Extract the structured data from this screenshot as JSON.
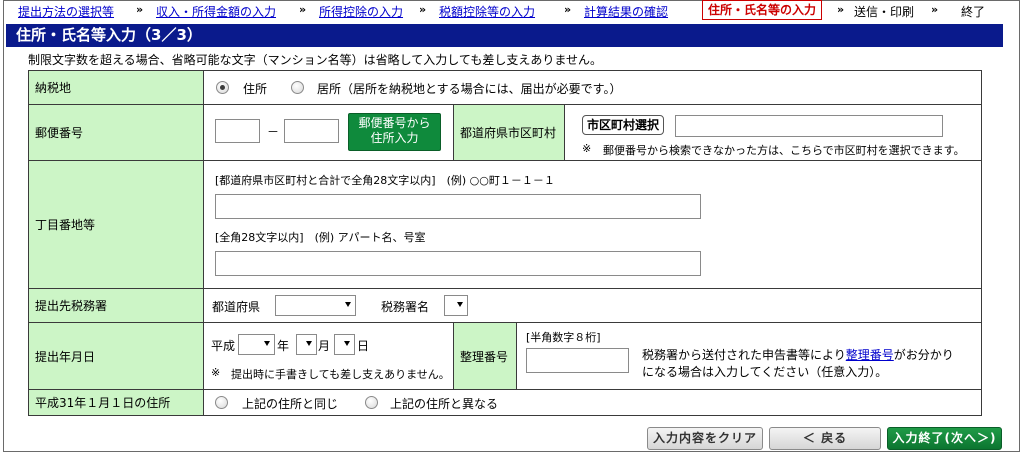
{
  "breadcrumb": {
    "steps": [
      {
        "label": "提出方法の選択等",
        "state": "link"
      },
      {
        "label": "収入・所得金額の入力",
        "state": "link"
      },
      {
        "label": "所得控除の入力",
        "state": "link"
      },
      {
        "label": "税額控除等の入力",
        "state": "link"
      },
      {
        "label": "計算結果の確認",
        "state": "link"
      },
      {
        "label": "住所・氏名等の入力",
        "state": "current"
      },
      {
        "label": "送信・印刷",
        "state": "plain"
      },
      {
        "label": "終了",
        "state": "plain"
      }
    ],
    "separator": "»"
  },
  "page_title": "住所・氏名等入力（3／3）",
  "notice": "制限文字数を超える場合、省略可能な文字（マンション名等）は省略して入力しても差し支えありません。",
  "rows": {
    "nozeichi": {
      "label": "納税地",
      "option_jusho": "住所",
      "option_kyosho": "居所（居所を納税地とする場合には、届出が必要です。）",
      "selected": "住所"
    },
    "yubin": {
      "label": "郵便番号",
      "part1": "",
      "dash": "－",
      "part2": "",
      "lookup_button": "郵便番号から\n住所入力",
      "pref_city_label": "都道府県市区町村",
      "city_select_button": "市区町村選択",
      "pref_city_value": "",
      "note_mark": "※",
      "note": "郵便番号から検索できなかった方は、こちらで市区町村を選択できます。"
    },
    "chome": {
      "label": "丁目番地等",
      "hint1": "[都道府県市区町村と合計で全角28文字以内]　(例) ○○町１－１－１",
      "value1": "",
      "hint2": "[全角28文字以内]　(例) アパート名、号室",
      "value2": ""
    },
    "zeimusho": {
      "label": "提出先税務署",
      "pref_label": "都道府県",
      "pref_value": "",
      "office_label": "税務署名",
      "office_value": ""
    },
    "teishutsu": {
      "label": "提出年月日",
      "era": "平成",
      "year_unit": "年",
      "month_unit": "月",
      "day_unit": "日",
      "note_mark": "※",
      "note": "提出時に手書きしても差し支えありません。",
      "seiri_label": "整理番号",
      "seiri_hint": "[半角数字８桁]",
      "seiri_value": "",
      "seiri_text_before": "税務署から送付された申告書等により",
      "seiri_link": "整理番号",
      "seiri_text_after": "がお分かり",
      "seiri_text_line2": "になる場合は入力してください（任意入力）。"
    },
    "h31": {
      "label": "平成31年１月１日の住所",
      "option_same": "上記の住所と同じ",
      "option_diff": "上記の住所と異なる"
    }
  },
  "buttons": {
    "clear": "入力内容をクリア",
    "back": "＜ 戻る",
    "next": "入力終了(次へ＞)"
  }
}
